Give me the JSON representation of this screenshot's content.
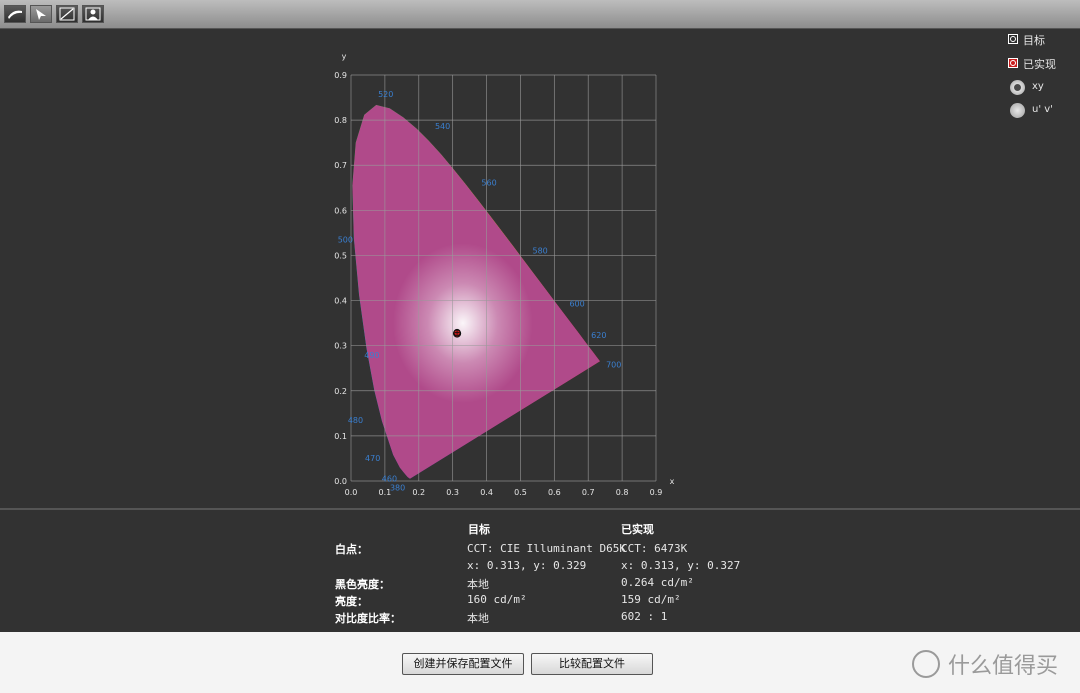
{
  "toolbar": {
    "tools": [
      {
        "name": "curve-tool-icon"
      },
      {
        "name": "pointer-tool-icon"
      },
      {
        "name": "line-tool-icon"
      },
      {
        "name": "person-tool-icon"
      }
    ]
  },
  "legend": {
    "target_label": "目标",
    "achieved_label": "已实现",
    "mode_xy": "xy",
    "mode_uv": "u' v'",
    "selected_mode": "xy"
  },
  "chart_data": {
    "type": "scatter",
    "xlabel": "x",
    "ylabel": "y",
    "xlim": [
      0.0,
      0.9
    ],
    "ylim": [
      0.0,
      0.9
    ],
    "x_ticks": [
      "0.0",
      "0.1",
      "0.2",
      "0.3",
      "0.4",
      "0.5",
      "0.6",
      "0.7",
      "0.8",
      "0.9"
    ],
    "y_ticks": [
      "0.0",
      "0.1",
      "0.2",
      "0.3",
      "0.4",
      "0.5",
      "0.6",
      "0.7",
      "0.8",
      "0.9"
    ],
    "grid": true,
    "wavelength_labels": [
      {
        "label": "520",
        "x": 0.074,
        "y": 0.834
      },
      {
        "label": "540",
        "x": 0.23,
        "y": 0.754
      },
      {
        "label": "560",
        "x": 0.373,
        "y": 0.624
      },
      {
        "label": "580",
        "x": 0.512,
        "y": 0.487
      },
      {
        "label": "600",
        "x": 0.627,
        "y": 0.373
      },
      {
        "label": "620",
        "x": 0.691,
        "y": 0.308
      },
      {
        "label": "700",
        "x": 0.735,
        "y": 0.265
      },
      {
        "label": "500",
        "x": 0.008,
        "y": 0.538
      },
      {
        "label": "490",
        "x": 0.045,
        "y": 0.295
      },
      {
        "label": "480",
        "x": 0.091,
        "y": 0.133
      },
      {
        "label": "470",
        "x": 0.124,
        "y": 0.058
      },
      {
        "label": "460",
        "x": 0.144,
        "y": 0.03
      },
      {
        "label": "380",
        "x": 0.174,
        "y": 0.005
      }
    ],
    "series": [
      {
        "name": "目标",
        "points": [
          [
            0.313,
            0.329
          ]
        ]
      },
      {
        "name": "已实现",
        "points": [
          [
            0.313,
            0.327
          ]
        ]
      }
    ]
  },
  "info": {
    "col_target_header": "目标",
    "col_achieved_header": "已实现",
    "rows": [
      {
        "label": "白点：",
        "target": "CCT: CIE Illuminant D65K",
        "achieved": "CCT: 6473K"
      },
      {
        "label": "",
        "target": "x: 0.313, y: 0.329",
        "achieved": "x: 0.313, y: 0.327"
      },
      {
        "label": "黑色亮度：",
        "target": "本地",
        "achieved": "0.264 cd/m²"
      },
      {
        "label": "亮度：",
        "target": "160 cd/m²",
        "achieved": "159 cd/m²"
      },
      {
        "label": "对比度比率：",
        "target": "本地",
        "achieved": "602 : 1"
      }
    ]
  },
  "buttons": {
    "create_save": "创建并保存配置文件",
    "compare": "比较配置文件"
  },
  "watermark": {
    "text": "什么值得买"
  }
}
